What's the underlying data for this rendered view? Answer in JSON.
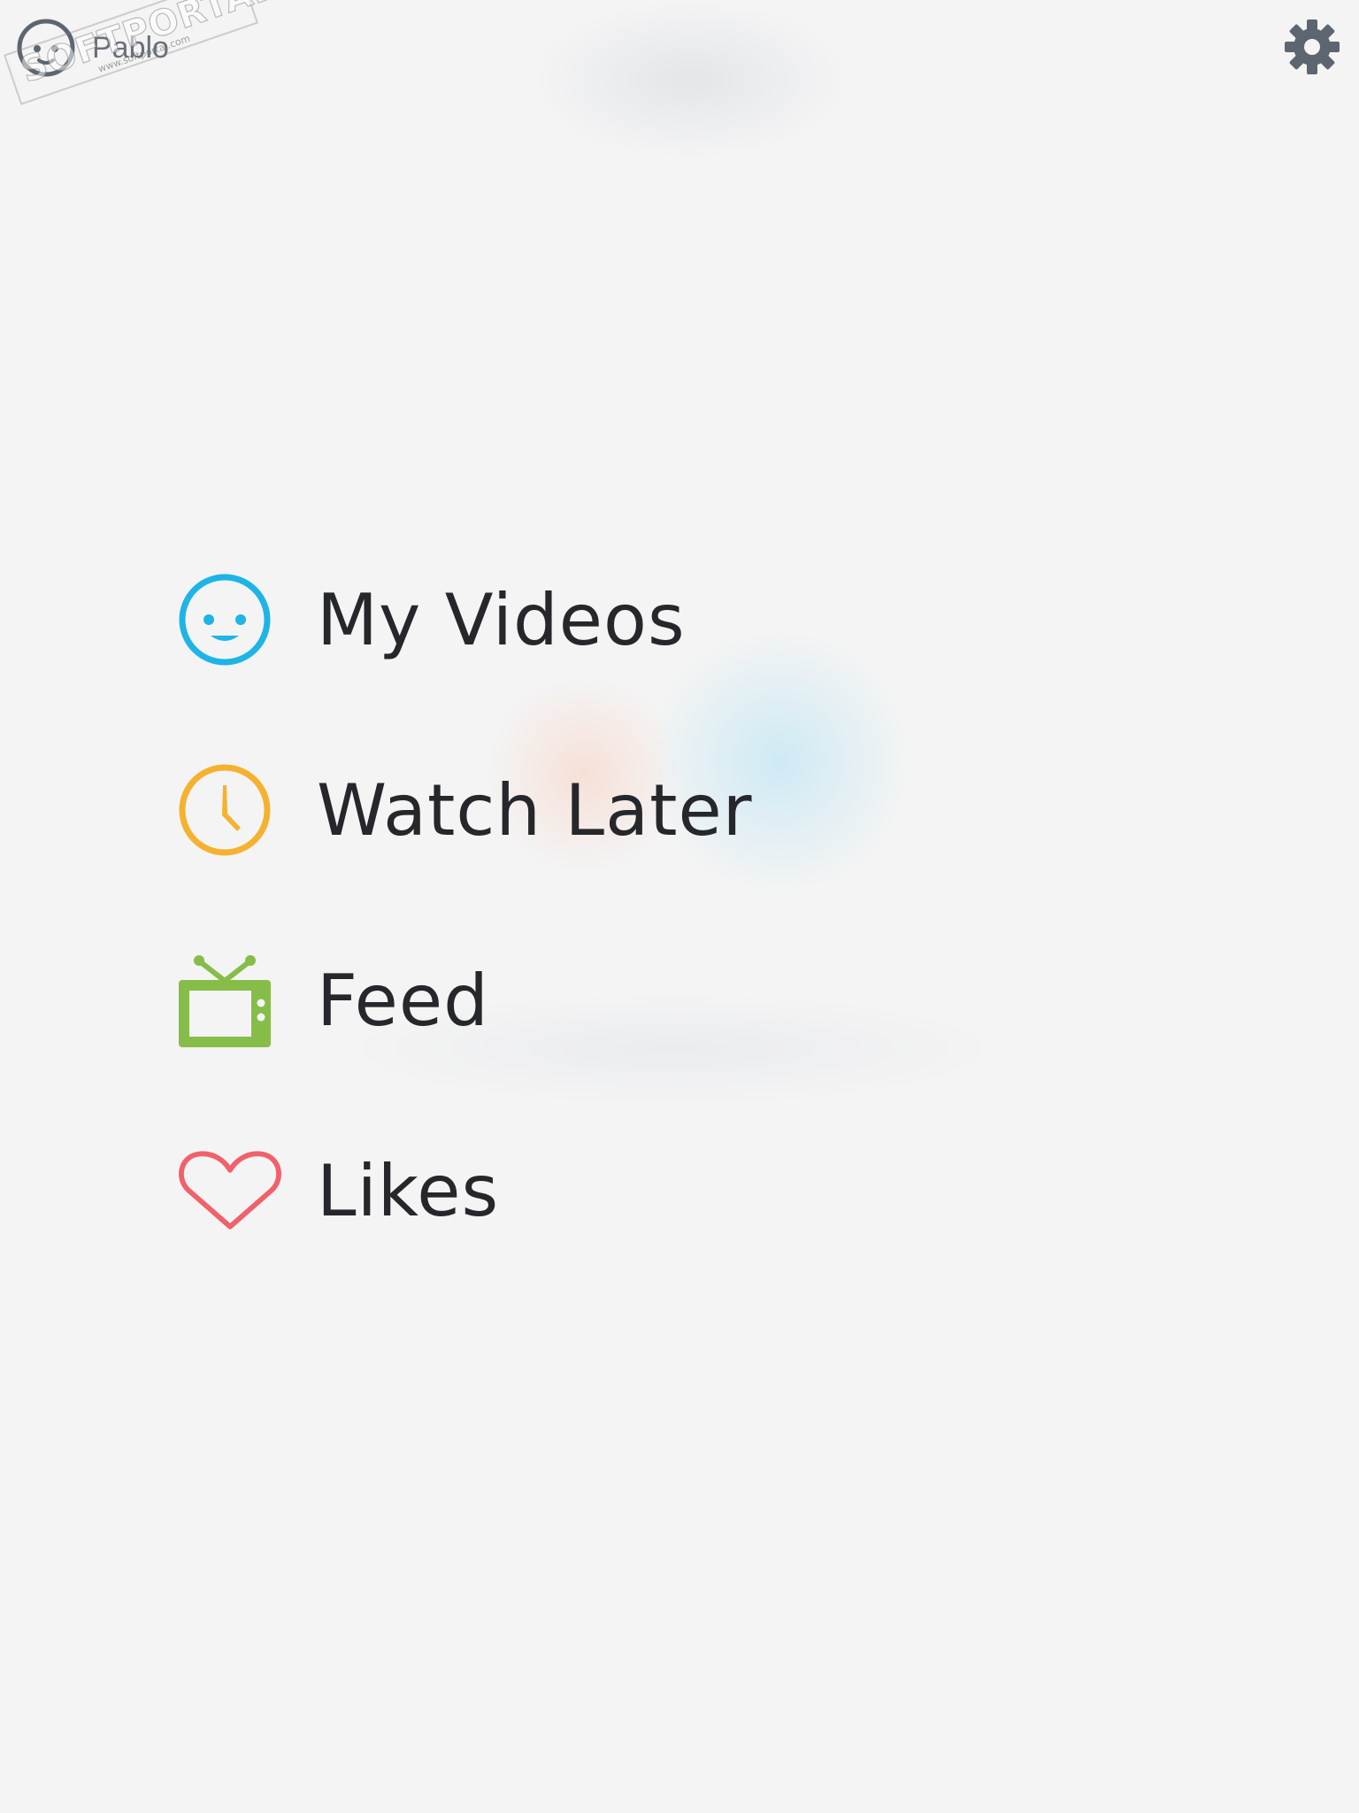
{
  "header": {
    "profile_name": "Pablo",
    "profile_icon": "smiley-face-icon",
    "settings_icon": "gear-icon"
  },
  "watermark": {
    "brand": "SOFTPORTAL",
    "tm": "™",
    "url": "www.softportal.com"
  },
  "menu": {
    "items": [
      {
        "label": "My Videos",
        "icon": "smiley-face-icon",
        "color": "#1eb4e6"
      },
      {
        "label": "Watch Later",
        "icon": "clock-icon",
        "color": "#f5b230"
      },
      {
        "label": "Feed",
        "icon": "tv-icon",
        "color": "#86bd48"
      },
      {
        "label": "Likes",
        "icon": "heart-icon",
        "color": "#f0616b"
      }
    ]
  },
  "colors": {
    "background": "#f4f4f4",
    "text": "#25272b",
    "header_icon": "#5d6670"
  }
}
